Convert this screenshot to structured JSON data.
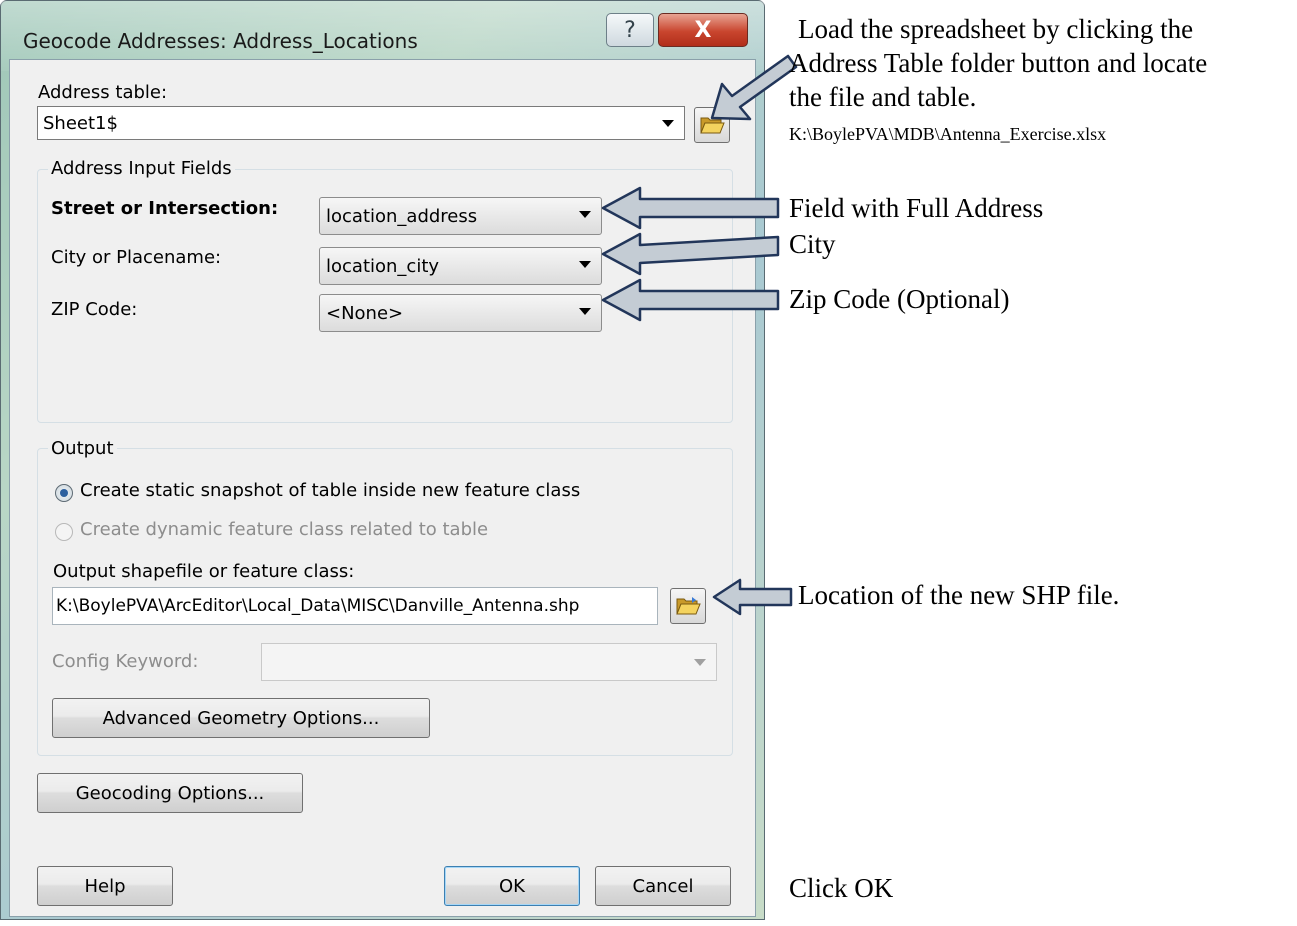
{
  "dialog": {
    "title": "Geocode Addresses:  Address_Locations",
    "help_glyph": "?",
    "close_glyph": "X",
    "address_table": {
      "label": "Address table:",
      "value": "Sheet1$"
    },
    "input_fields": {
      "group_title": "Address Input Fields",
      "street": {
        "label": "Street or Intersection:",
        "value": "location_address"
      },
      "city": {
        "label": "City or Placename:",
        "value": "location_city"
      },
      "zip": {
        "label": "ZIP Code:",
        "value": "<None>"
      }
    },
    "output": {
      "group_title": "Output",
      "radio_static": {
        "label": "Create static snapshot of table inside new feature class",
        "checked": true
      },
      "radio_dynamic": {
        "label": "Create dynamic feature class related to table",
        "checked": false,
        "enabled": false
      },
      "output_label": "Output shapefile or feature class:",
      "output_value": "K:\\BoylePVA\\ArcEditor\\Local_Data\\MISC\\Danville_Antenna.shp",
      "config_label": "Config Keyword:",
      "config_value": "",
      "advanced_button": "Advanced Geometry Options..."
    },
    "geocoding_options_button": "Geocoding Options...",
    "help_button": "Help",
    "ok_button": "OK",
    "cancel_button": "Cancel"
  },
  "annotations": {
    "load_line1": "Load the spreadsheet by clicking the",
    "load_line2": "Address Table folder button and locate",
    "load_line3": "the file and table.",
    "load_path": "K:\\BoylePVA\\MDB\\Antenna_Exercise.xlsx",
    "street_note": "Field with Full Address",
    "city_note": "City",
    "zip_note": "Zip Code (Optional)",
    "shp_note": "Location of the new SHP file.",
    "ok_note": "Click OK"
  },
  "colors": {
    "arrow_fill": "#c4ccd4",
    "arrow_outline": "#22365a",
    "close_red": "#c9452e"
  }
}
